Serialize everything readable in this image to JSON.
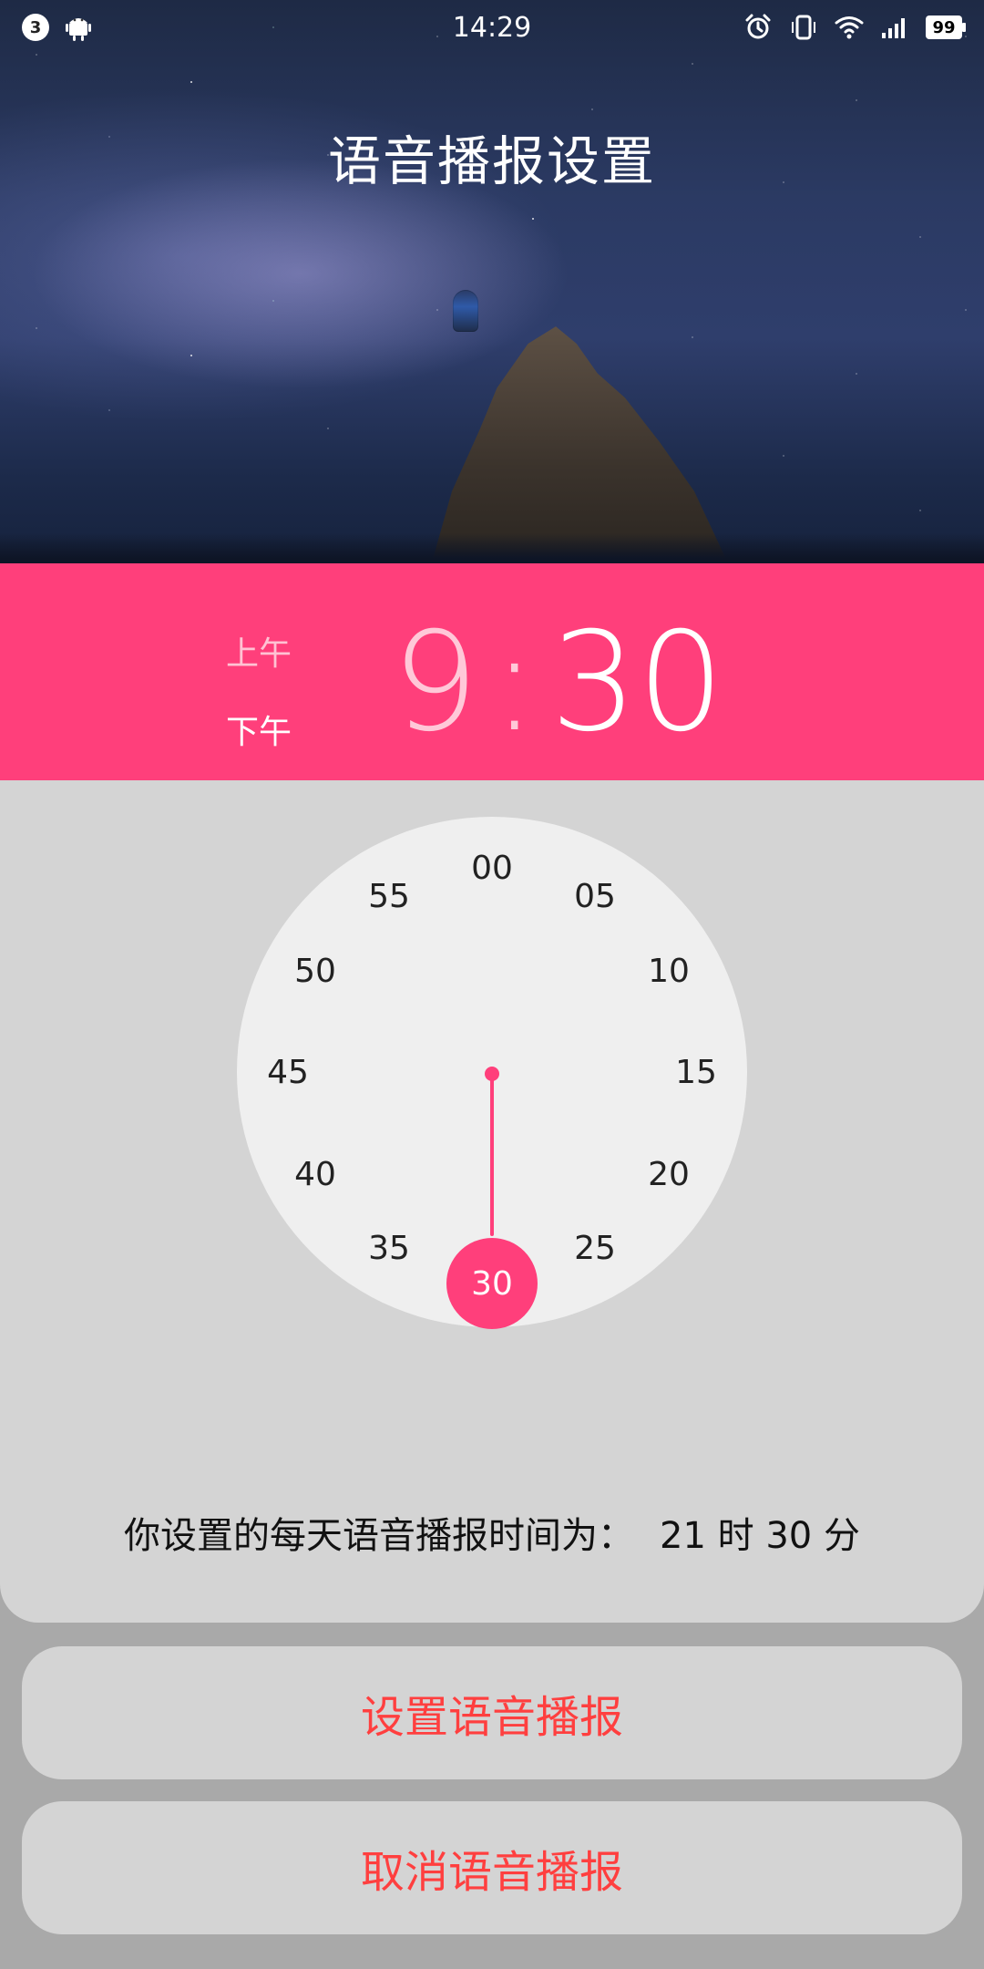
{
  "status_bar": {
    "notification_count": "3",
    "time": "14:29",
    "battery_level": "99",
    "icons": [
      "alarm-icon",
      "vibrate-icon",
      "wifi-icon",
      "signal-icon",
      "battery-icon"
    ]
  },
  "header": {
    "title": "语音播报设置"
  },
  "time_picker": {
    "am_label": "上午",
    "pm_label": "下午",
    "hour": "9",
    "separator": ":",
    "minute": "30"
  },
  "clock": {
    "numbers": [
      "00",
      "05",
      "10",
      "15",
      "20",
      "25",
      "30",
      "35",
      "40",
      "45",
      "50",
      "55"
    ],
    "selected": "30"
  },
  "summary": {
    "prefix": "你设置的每天语音播报时间为：",
    "hour": "21",
    "hour_unit": "时",
    "minute": "30",
    "minute_unit": "分"
  },
  "buttons": {
    "set": "设置语音播报",
    "cancel": "取消语音播报"
  },
  "colors": {
    "accent": "#ff3f7b",
    "button_text": "#ff3f3f"
  }
}
